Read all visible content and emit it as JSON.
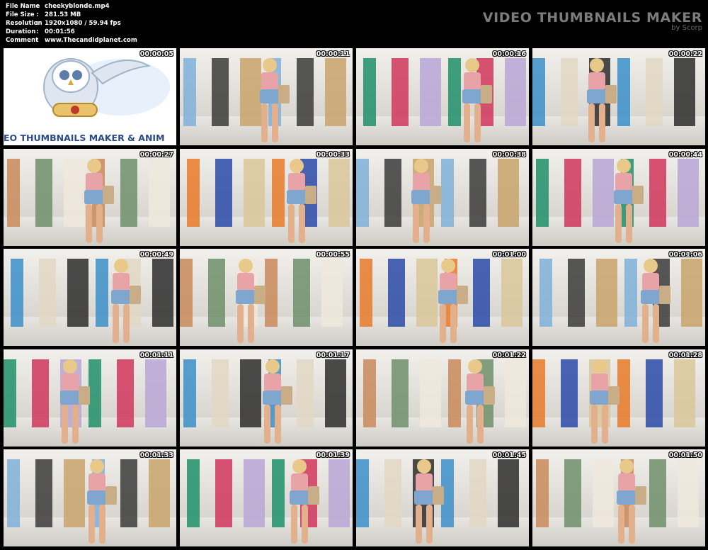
{
  "info": {
    "file_name_label": "File Name",
    "file_name": "cheekyblonde.mp4",
    "file_size_label": "File Size",
    "file_size": "281.53 MB",
    "resolution_label": "Resolution",
    "resolution": "1920x1080 / 59.94 fps",
    "duration_label": "Duration",
    "duration": "00:01:56",
    "comment_label": "Comment",
    "comment": "www.Thecandidplanet.com"
  },
  "brand": {
    "title": "VIDEO THUMBNAILS MAKER",
    "subtitle": "by Scorp"
  },
  "logo_banner": "EO THUMBNAILS MAKER & ANIM",
  "thumbnails": [
    "00:00:05",
    "00:00:11",
    "00:00:16",
    "00:00:22",
    "00:00:27",
    "00:00:33",
    "00:00:38",
    "00:00:44",
    "00:00:49",
    "00:00:55",
    "00:01:00",
    "00:01:06",
    "00:01:11",
    "00:01:17",
    "00:01:22",
    "00:01:28",
    "00:01:33",
    "00:01:39",
    "00:01:45",
    "00:01:50"
  ]
}
